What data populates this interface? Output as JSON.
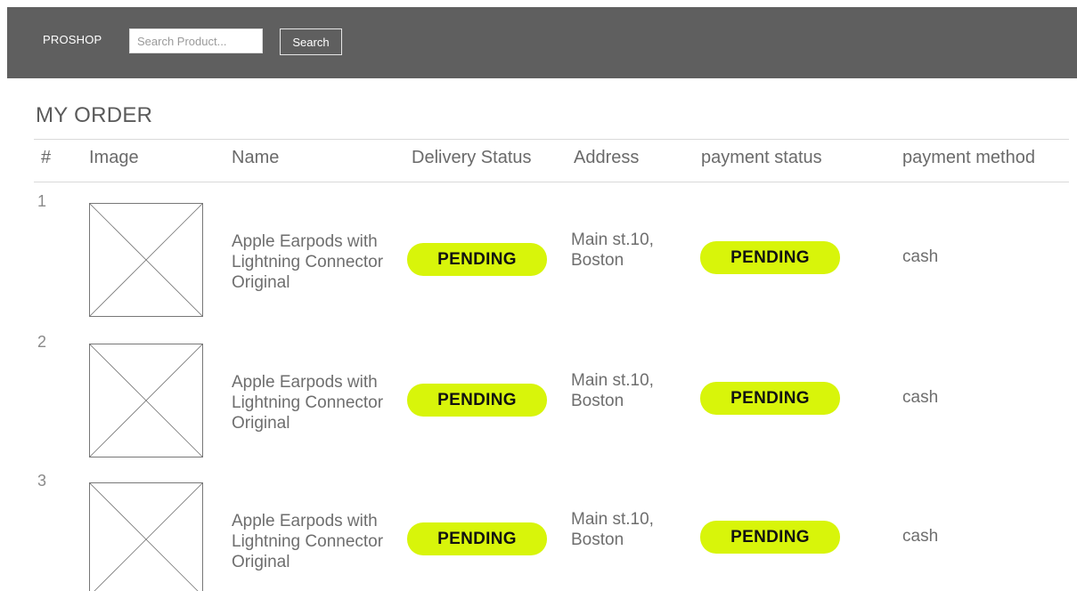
{
  "navbar": {
    "brand": "PROSHOP",
    "search_placeholder": "Search Product...",
    "search_button": "Search"
  },
  "page": {
    "title": "MY ORDER"
  },
  "table": {
    "columns": [
      "#",
      "Image",
      "Name",
      "Delivery Status",
      "Address",
      "payment status",
      "payment method"
    ],
    "rows": [
      {
        "num": "1",
        "image_icon": "image-placeholder-icon",
        "name": "Apple Earpods with Lightning Connector Original",
        "delivery_status": "PENDING",
        "address": "Main st.10, Boston",
        "payment_status": "PENDING",
        "payment_method": "cash"
      },
      {
        "num": "2",
        "image_icon": "image-placeholder-icon",
        "name": "Apple Earpods with Lightning Connector Original",
        "delivery_status": "PENDING",
        "address": "Main st.10, Boston",
        "payment_status": "PENDING",
        "payment_method": "cash"
      },
      {
        "num": "3",
        "image_icon": "image-placeholder-icon",
        "name": "Apple Earpods with Lightning Connector Original",
        "delivery_status": "PENDING",
        "address": "Main st.10, Boston",
        "payment_status": "PENDING",
        "payment_method": "cash"
      }
    ]
  },
  "colors": {
    "navbar_bg": "#5f5f5f",
    "badge_bg": "#d8f50a",
    "badge_text": "#111111",
    "text_gray": "#6e6e6e"
  }
}
